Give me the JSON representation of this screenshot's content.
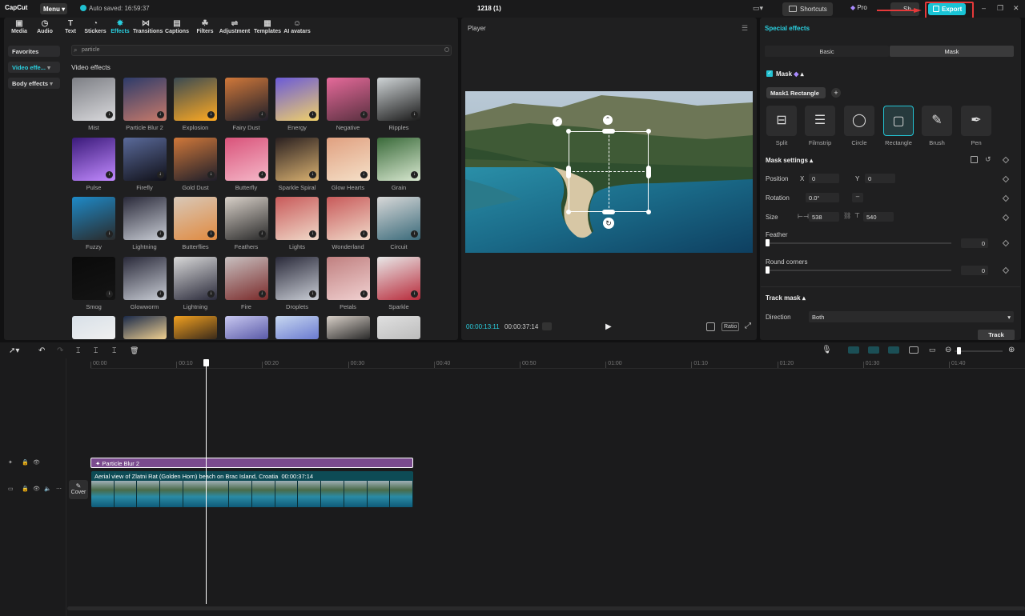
{
  "app": {
    "logo": "CapCut",
    "menu_label": "Menu",
    "autosave": "Auto saved: 16:59:37",
    "project_name": "1218 (1)",
    "shortcuts_label": "Shortcuts",
    "pro_label": "Pro",
    "share_label": "Sh",
    "export_label": "Export",
    "accent": "#19c4d6",
    "highlight": "#e5393a"
  },
  "tabs": [
    {
      "label": "Media",
      "icon": "media-icon"
    },
    {
      "label": "Audio",
      "icon": "audio-icon"
    },
    {
      "label": "Text",
      "icon": "text-icon"
    },
    {
      "label": "Stickers",
      "icon": "stickers-icon"
    },
    {
      "label": "Effects",
      "icon": "effects-icon"
    },
    {
      "label": "Transitions",
      "icon": "transitions-icon"
    },
    {
      "label": "Captions",
      "icon": "captions-icon"
    },
    {
      "label": "Filters",
      "icon": "filters-icon"
    },
    {
      "label": "Adjustment",
      "icon": "adjustment-icon"
    },
    {
      "label": "Templates",
      "icon": "templates-icon"
    },
    {
      "label": "AI avatars",
      "icon": "ai-avatars-icon"
    }
  ],
  "sidebar": {
    "favorites": "Favorites",
    "video_effects": "Video effe...",
    "body_effects": "Body effects"
  },
  "search": {
    "value": "particle"
  },
  "effects": {
    "section_title": "Video effects",
    "items": [
      "Mist",
      "Particle Blur 2",
      "Explosion",
      "Fairy Dust",
      "Energy",
      "Negative",
      "Ripples",
      "Pulse",
      "Firefly",
      "Gold Dust",
      "Butterfly",
      "Sparkle Spiral",
      "Glow Hearts",
      "Grain",
      "Fuzzy",
      "Lightning",
      "Butterflies",
      "Feathers",
      "Lights",
      "Wonderland",
      "Circuit",
      "Smog",
      "Glowworm",
      "Lightning",
      "Fire",
      "Droplets",
      "Petals",
      "Sparkle",
      "",
      "",
      "",
      "",
      "",
      "",
      ""
    ]
  },
  "player": {
    "title": "Player",
    "current_time": "00:00:13:11",
    "total_time": "00:00:37:14",
    "ratio_label": "Ratio"
  },
  "right_panel": {
    "title": "Special effects",
    "tab_basic": "Basic",
    "tab_mask": "Mask",
    "mask_label": "Mask",
    "mask_name": "Mask1 Rectangle",
    "shapes": [
      "Split",
      "Filmstrip",
      "Circle",
      "Rectangle",
      "Brush",
      "Pen"
    ],
    "mask_settings": "Mask settings",
    "position_label": "Position",
    "pos_x_label": "X",
    "pos_x": "0",
    "pos_y_label": "Y",
    "pos_y": "0",
    "rotation_label": "Rotation",
    "rotation": "0.0°",
    "size_label": "Size",
    "size_w": "538",
    "size_h": "540",
    "feather_label": "Feather",
    "feather": "0",
    "round_label": "Round corners",
    "round": "0",
    "track_mask": "Track mask",
    "direction_label": "Direction",
    "direction": "Both",
    "track_button": "Track"
  },
  "timeline": {
    "ruler": [
      "00:00",
      "00:10",
      "00:20",
      "00:30",
      "00:40",
      "00:50",
      "01:00",
      "01:10",
      "01:20",
      "01:30",
      "01:40"
    ],
    "effect_clip": "Particle Blur 2",
    "video_clip": "Aerial view of Zlatni Rat (Golden Horn) beach on Brac Island, Croatia",
    "video_duration": "00:00:37:14",
    "cover_label": "Cover"
  }
}
